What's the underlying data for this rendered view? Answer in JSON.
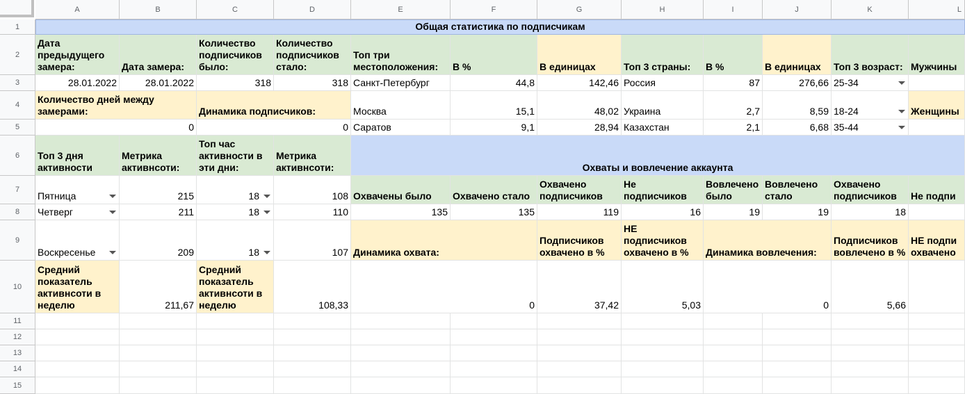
{
  "columns": [
    "A",
    "B",
    "C",
    "D",
    "E",
    "F",
    "G",
    "H",
    "I",
    "J",
    "K",
    "L"
  ],
  "rows": [
    "1",
    "2",
    "3",
    "4",
    "5",
    "6",
    "7",
    "8",
    "9",
    "10",
    "11",
    "12",
    "13",
    "14",
    "15"
  ],
  "cells": {
    "title": "Общая статистика по подписчикам",
    "a2": "Дата предыдущего замера:",
    "b2": "Дата замера:",
    "c2": "Количество подписчиков было:",
    "d2": "Количество подписчиков стало:",
    "e2": "Топ три местоположения:",
    "f2": "В %",
    "g2": "В единицах",
    "h2": "Топ 3 страны:",
    "i2": "В %",
    "j2": "В единицах",
    "k2": "Топ 3 возраст:",
    "l2": "Мужчины",
    "a3": "28.01.2022",
    "b3": "28.01.2022",
    "c3": "318",
    "d3": "318",
    "e3": "Санкт-Петербург",
    "f3": "44,8",
    "g3": "142,46",
    "h3": "Россия",
    "i3": "87",
    "j3": "276,66",
    "k3": "25-34",
    "a4": "Количество дней между замерами:",
    "c4": "Динамика подписчиков:",
    "e4": "Москва",
    "f4": "15,1",
    "g4": "48,02",
    "h4": "Украина",
    "i4": "2,7",
    "j4": "8,59",
    "k4": "18-24",
    "l4": "Женщины",
    "a5": "0",
    "c5": "0",
    "e5": "Саратов",
    "f5": "9,1",
    "g5": "28,94",
    "h5": "Казахстан",
    "i5": "2,1",
    "j5": "6,68",
    "k5": "35-44",
    "a6": "Топ 3 дня активности",
    "b6": "Метрика активнсоти:",
    "c6": "Топ час активности в эти дни:",
    "d6": "Метрика активнсоти:",
    "e6": "Охваты и вовлечение аккаунта",
    "a7": "Пятница",
    "b7": "215",
    "c7": "18",
    "d7": "108",
    "e7": "Охвачены было",
    "f7": "Охвачено стало",
    "g7": "Охвачено подписчиков",
    "h7": "Не подписчиков",
    "i7": "Вовлечено было",
    "j7": "Вовлечено стало",
    "k7": "Охвачено подписчиков",
    "l7": "Не подпи",
    "a8": "Четверг",
    "b8": "211",
    "c8": "18",
    "d8": "110",
    "e8": "135",
    "f8": "135",
    "g8": "119",
    "h8": "16",
    "i8": "19",
    "j8": "19",
    "k8": "18",
    "a9": "Воскресенье",
    "b9": "209",
    "c9": "18",
    "d9": "107",
    "e9": "Динамика охвата:",
    "g9": "Подписчиков охвачено в %",
    "h9": "НЕ подписчиков охвачено в %",
    "i9": "Динамика вовлечения:",
    "k9": "Подписчиков вовлечено в %",
    "l9": "НЕ подпи охвачено",
    "a10": "Средний показатель активнсоти в неделю",
    "b10": "211,67",
    "c10": "Средний показатель активнсоти в неделю",
    "d10": "108,33",
    "e10": "0",
    "g10": "37,42",
    "h10": "5,03",
    "i10": "0",
    "k10": "5,66"
  },
  "colors": {
    "blue": "#c9daf8",
    "green": "#d9ead3",
    "yellow": "#fff2cc",
    "header_bg": "#f8f9fa"
  }
}
